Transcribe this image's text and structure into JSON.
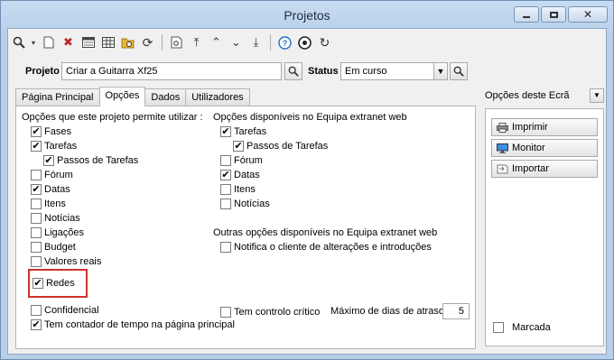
{
  "window": {
    "title": "Projetos"
  },
  "toolbar": {
    "icons": [
      "search-icon",
      "dropdown-arrow-icon",
      "new-document-icon",
      "delete-icon",
      "list-view-icon",
      "table-view-icon",
      "folder-search-icon",
      "refresh-icon",
      "print-preview-icon",
      "first-record-icon",
      "prev-record-icon",
      "next-record-icon",
      "last-record-icon",
      "help-icon",
      "web-icon",
      "reload-icon"
    ]
  },
  "project": {
    "label": "Projeto",
    "value": "Criar a Guitarra Xf25",
    "status_label": "Status",
    "status_value": "Em curso"
  },
  "tabs": [
    {
      "label": "Página Principal"
    },
    {
      "label": "Opções"
    },
    {
      "label": "Dados"
    },
    {
      "label": "Utilizadores"
    }
  ],
  "options": {
    "heading": "Opções que este projeto permite utilizar :",
    "items": [
      {
        "label": "Fases",
        "checked": true
      },
      {
        "label": "Tarefas",
        "checked": true
      },
      {
        "label": "Passos de Tarefas",
        "checked": true
      },
      {
        "label": "Fórum",
        "checked": false
      },
      {
        "label": "Datas",
        "checked": true
      },
      {
        "label": "Itens",
        "checked": false
      },
      {
        "label": "Notícias",
        "checked": false
      },
      {
        "label": "Ligações",
        "checked": false
      },
      {
        "label": "Budget",
        "checked": false
      },
      {
        "label": "Valores reais",
        "checked": false
      },
      {
        "label": "Redes",
        "checked": true
      }
    ]
  },
  "extranet": {
    "heading": "Opções disponíveis no Equipa extranet web",
    "items": [
      {
        "label": "Tarefas",
        "checked": true
      },
      {
        "label": "Passos de Tarefas",
        "checked": true
      },
      {
        "label": "Fórum",
        "checked": false
      },
      {
        "label": "Datas",
        "checked": true
      },
      {
        "label": "Itens",
        "checked": false
      },
      {
        "label": "Notícias",
        "checked": false
      }
    ]
  },
  "other": {
    "heading": "Outras opções disponíveis no Equipa extranet web",
    "notify_label": "Notifica o cliente de alterações e introduções",
    "notify_checked": false
  },
  "bottom": {
    "confidencial_label": "Confidencial",
    "confidencial_checked": false,
    "contador_label": "Tem contador de tempo na página principal",
    "contador_checked": true,
    "critico_label": "Tem controlo crítico",
    "critico_checked": false,
    "max_dias_label": "Máximo de dias de atraso",
    "max_dias_value": "5"
  },
  "side": {
    "header": "Opções deste Ecrã",
    "buttons": [
      {
        "label": "Imprimir",
        "icon": "printer-icon"
      },
      {
        "label": "Monitor",
        "icon": "monitor-icon"
      },
      {
        "label": "Importar",
        "icon": "import-icon"
      }
    ],
    "marcada_label": "Marcada",
    "marcada_checked": false
  },
  "check_glyph": "✔"
}
